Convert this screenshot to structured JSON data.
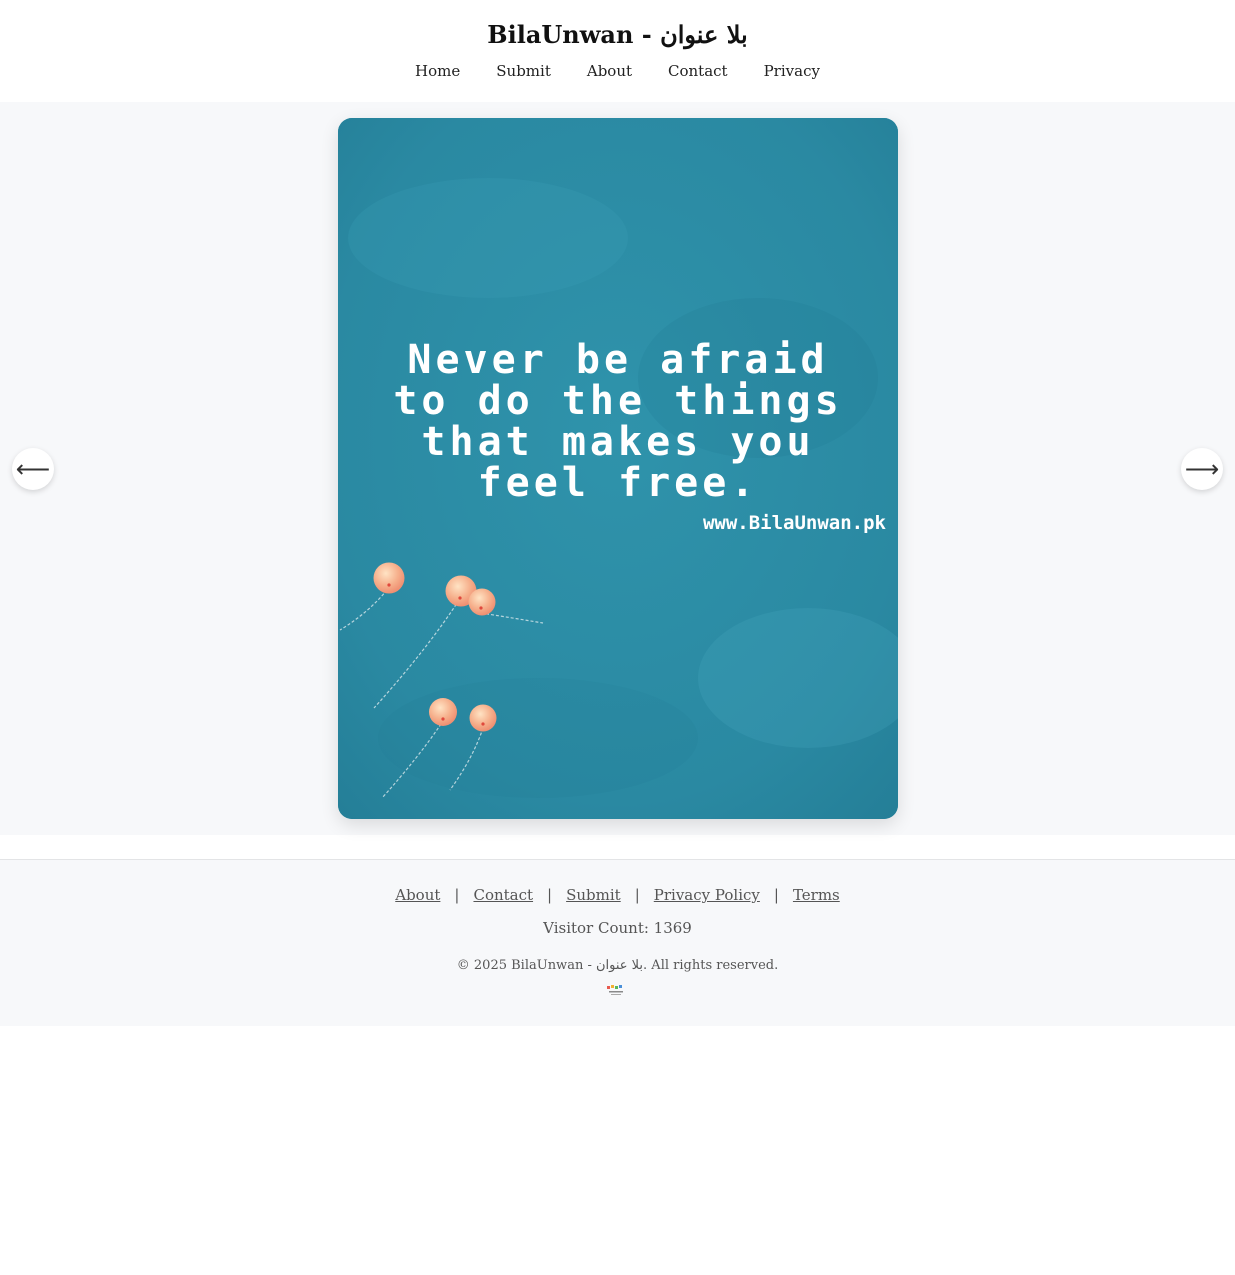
{
  "header": {
    "title": "BilaUnwan - بلا عنوان",
    "nav": [
      "Home",
      "Submit",
      "About",
      "Contact",
      "Privacy"
    ]
  },
  "viewer": {
    "quote_lines": [
      "Never be afraid",
      "to do the things",
      "that makes you",
      "feel free."
    ],
    "watermark": "www.BilaUnwan.pk",
    "prev_arrow": "⟵",
    "next_arrow": "⟶",
    "image_background_color": "#2d8ea6",
    "balloon_color": "#f4a882"
  },
  "footer": {
    "links": [
      "About",
      "Contact",
      "Submit",
      "Privacy Policy",
      "Terms"
    ],
    "separator": "|",
    "visitor_count": "Visitor Count: 1369",
    "copyright": "© 2025 BilaUnwan - بلا عنوان. All rights reserved."
  }
}
